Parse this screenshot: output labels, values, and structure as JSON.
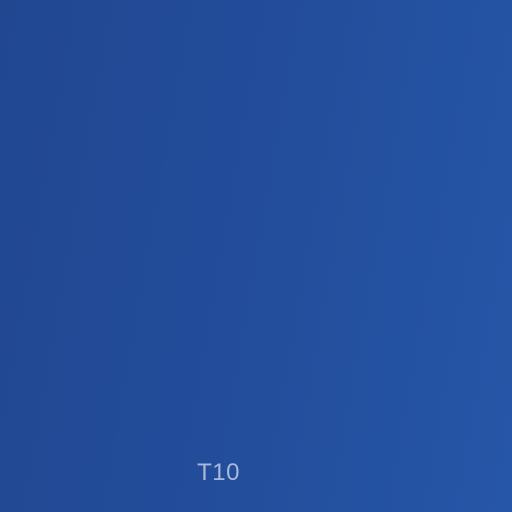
{
  "screen": {
    "background_colors": [
      "#214791",
      "#234e9c",
      "#2656a8"
    ],
    "label": "T10",
    "label_color": "#a9b9dc"
  }
}
